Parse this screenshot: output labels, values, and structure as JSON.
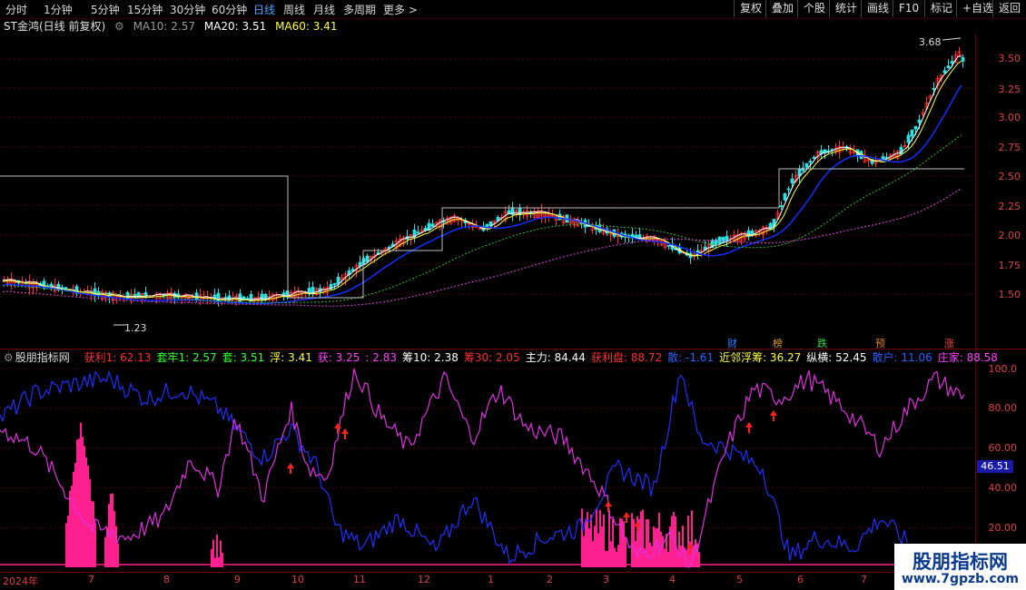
{
  "toolbar": {
    "periods": [
      "分时",
      "1分钟",
      "5分钟",
      "15分钟",
      "30分钟",
      "60分钟",
      "日线",
      "周线",
      "月线",
      "多周期",
      "更多 >"
    ],
    "active_period": "日线",
    "actions": [
      "复权",
      "叠加",
      "个股",
      "统计",
      "画线",
      "F10",
      "标记",
      "+自选",
      "返回"
    ]
  },
  "main": {
    "title": "ST金鸿(日线 前复权)",
    "ma10": "MA10: 2.57",
    "ma20": "MA20: 3.51",
    "ma60": "MA60: 3.41",
    "high_label": "3.68",
    "low_label": "1.23",
    "price_axis": [
      "3.50",
      "3.25",
      "3.00",
      "2.75",
      "2.50",
      "2.25",
      "2.00",
      "1.75",
      "1.50"
    ],
    "tags": [
      "财",
      "榜",
      "跌",
      "预",
      "涨"
    ]
  },
  "indicator": {
    "name": "股朋指标网",
    "values": [
      {
        "text": "获利1: 62.13",
        "color": "#ff3030"
      },
      {
        "text": "套牢1: 2.57",
        "color": "#30ff30"
      },
      {
        "text": "套: 3.51",
        "color": "#30ff30"
      },
      {
        "text": "浮: 3.41",
        "color": "#ffff40"
      },
      {
        "text": "获: 3.25",
        "color": "#ff40ff"
      },
      {
        "text": ": 2.83",
        "color": "#ff40ff"
      },
      {
        "text": "筹10: 2.38",
        "color": "#ffffff"
      },
      {
        "text": "筹30: 2.05",
        "color": "#ff3030"
      },
      {
        "text": "主力: 84.44",
        "color": "#ffffff"
      },
      {
        "text": "获利盘: 88.72",
        "color": "#ff3030"
      },
      {
        "text": "散: -1.61",
        "color": "#3060ff"
      },
      {
        "text": "近邻浮筹: 36.27",
        "color": "#ffff40"
      },
      {
        "text": "纵横: 52.45",
        "color": "#ffffff"
      },
      {
        "text": "散户: 11.06",
        "color": "#3060ff"
      },
      {
        "text": "庄家: 88.58",
        "color": "#ff40ff"
      }
    ],
    "axis": [
      "100.0",
      "80.00",
      "60.00",
      "40.00",
      "20.00"
    ],
    "current_value": "46.51"
  },
  "dates": [
    "2024年",
    "7",
    "8",
    "9",
    "10",
    "11",
    "12",
    "1",
    "2",
    "3",
    "4",
    "5",
    "6",
    "7"
  ],
  "watermark": {
    "title": "股朋指标网",
    "url": "www.7gpzb.com"
  },
  "colors": {
    "up": "#ff3030",
    "down": "#30e0e0",
    "ma10": "#ffffff",
    "ma20": "#ffff40",
    "ma60": "#1030ff",
    "chip": "#ff2090"
  }
}
